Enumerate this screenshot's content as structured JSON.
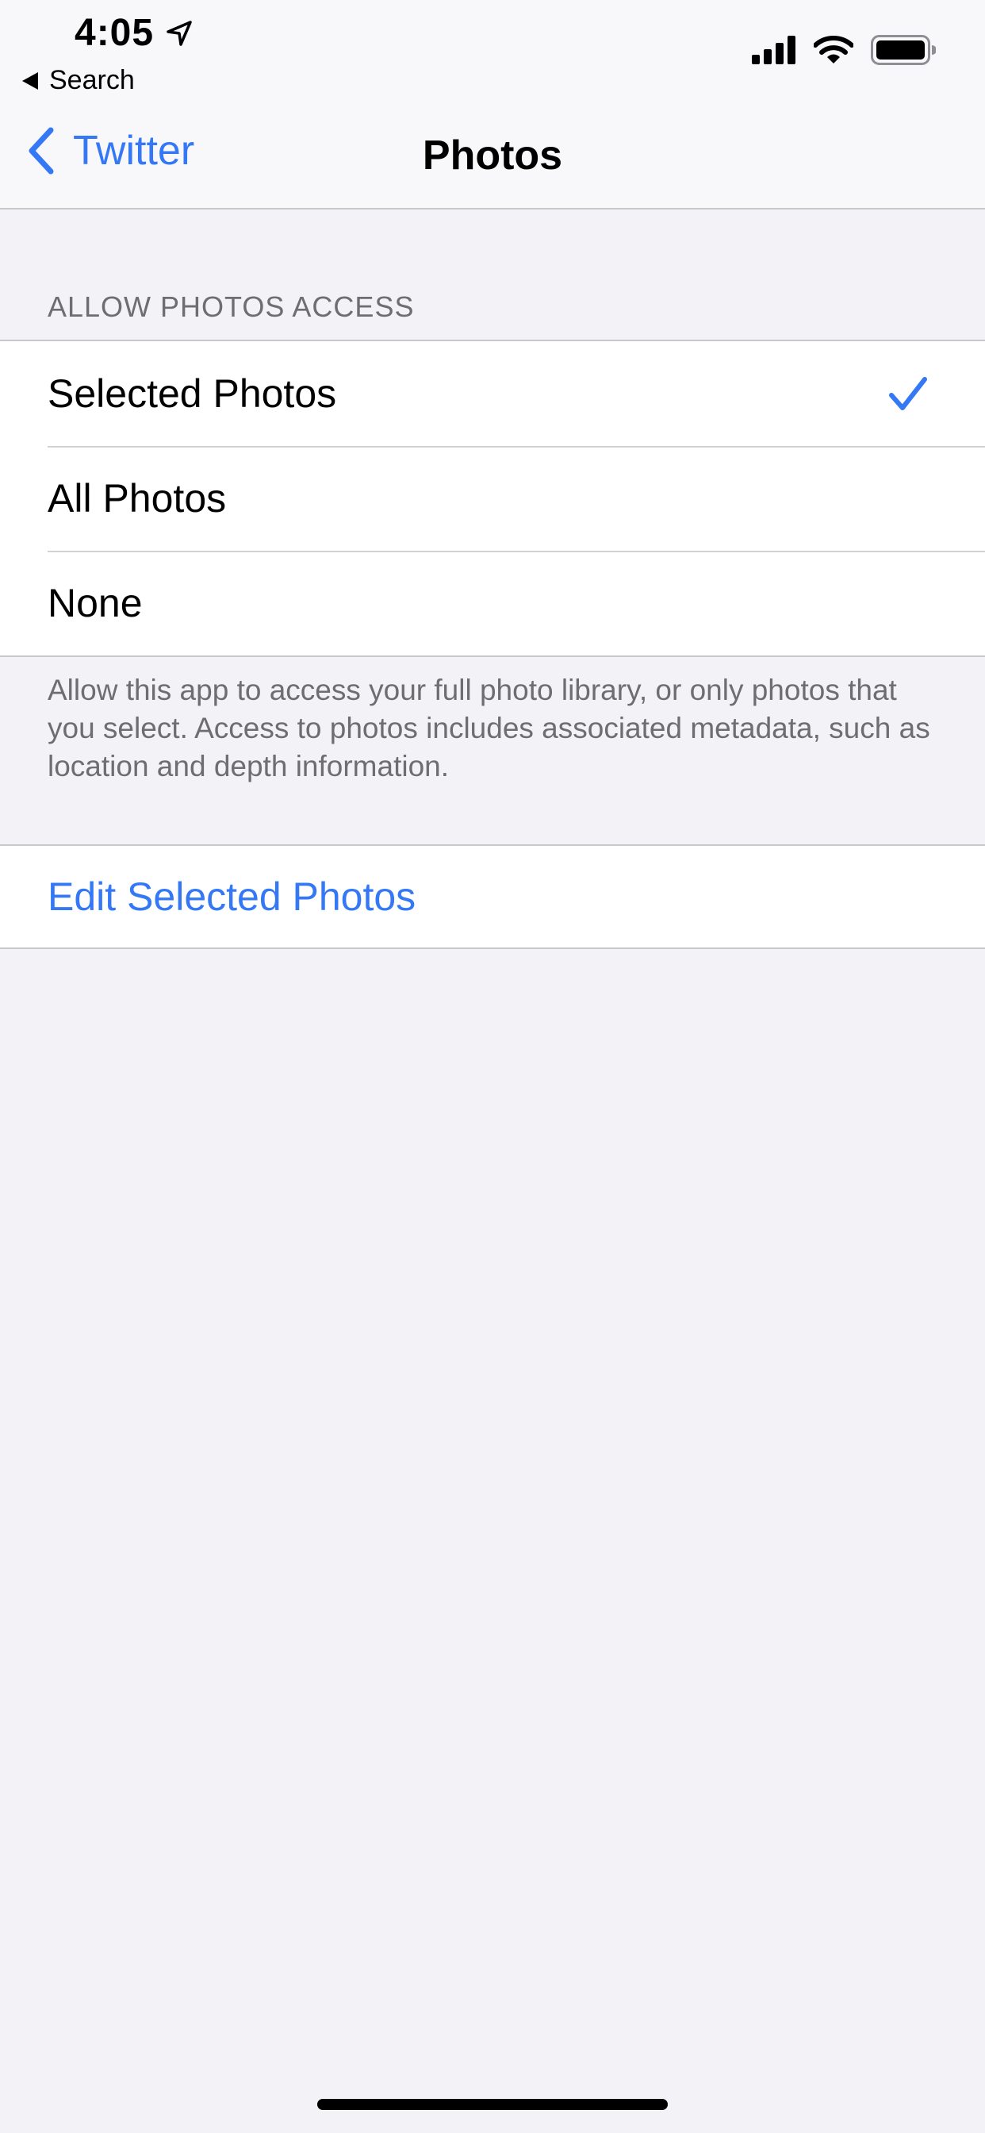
{
  "status_bar": {
    "time": "4:05",
    "back_app_label": "Search"
  },
  "nav": {
    "back_label": "Twitter",
    "title": "Photos"
  },
  "section": {
    "header": "ALLOW PHOTOS ACCESS",
    "options": [
      {
        "label": "Selected Photos",
        "selected": true
      },
      {
        "label": "All Photos",
        "selected": false
      },
      {
        "label": "None",
        "selected": false
      }
    ],
    "footer": "Allow this app to access your full photo library, or only photos that you select. Access to photos includes associated metadata, such as location and depth information."
  },
  "actions": {
    "edit_label": "Edit Selected Photos"
  },
  "colors": {
    "accent": "#3478f6",
    "background": "#f2f2f7",
    "secondary_text": "#6d6d72"
  },
  "icons": [
    "location-arrow-icon",
    "back-triangle-icon",
    "cellular-signal-icon",
    "wifi-icon",
    "battery-icon",
    "chevron-left-icon",
    "checkmark-icon"
  ]
}
